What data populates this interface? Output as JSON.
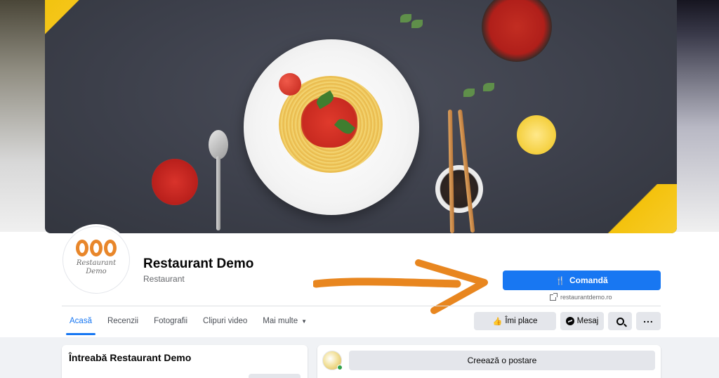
{
  "page": {
    "name": "Restaurant Demo",
    "category": "Restaurant",
    "logo_text_line1": "Restaurant",
    "logo_text_line2": "Demo",
    "website": "restaurantdemo.ro"
  },
  "actions": {
    "order_label": "Comandă",
    "like_label": "Îmi place",
    "message_label": "Mesaj"
  },
  "tabs": [
    {
      "label": "Acasă",
      "active": true
    },
    {
      "label": "Recenzii",
      "active": false
    },
    {
      "label": "Fotografii",
      "active": false
    },
    {
      "label": "Clipuri video",
      "active": false
    },
    {
      "label": "Mai multe",
      "active": false
    }
  ],
  "ask_card": {
    "title": "Întreabă Restaurant Demo"
  },
  "composer": {
    "create_post_label": "Creează o postare"
  },
  "icons": {
    "order": "utensils-icon",
    "website": "external-link-icon",
    "like": "thumbs-up-icon",
    "message": "messenger-icon",
    "search": "search-icon",
    "more": "more-dots-icon",
    "dropdown": "caret-down-icon"
  },
  "colors": {
    "primary": "#1877f2",
    "annotation_arrow": "#e8861f",
    "logo_orange": "#e8862a",
    "online": "#31a24c"
  }
}
